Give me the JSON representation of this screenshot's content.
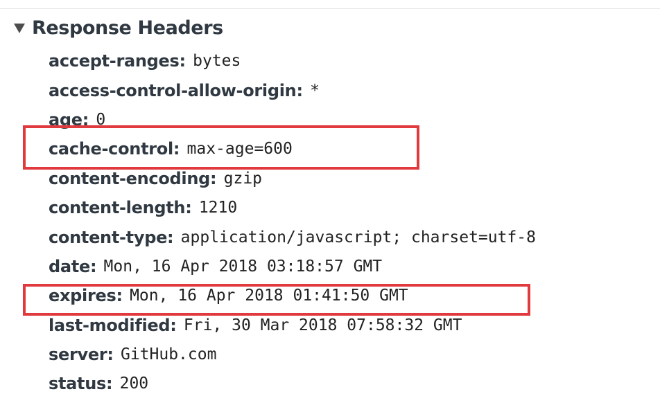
{
  "section": {
    "title": "Response Headers",
    "expanded_icon": "triangle-down-icon"
  },
  "headers": [
    {
      "name": "accept-ranges",
      "value": "bytes"
    },
    {
      "name": "access-control-allow-origin",
      "value": "*"
    },
    {
      "name": "age",
      "value": "0"
    },
    {
      "name": "cache-control",
      "value": "max-age=600"
    },
    {
      "name": "content-encoding",
      "value": "gzip"
    },
    {
      "name": "content-length",
      "value": "1210"
    },
    {
      "name": "content-type",
      "value": "application/javascript; charset=utf-8"
    },
    {
      "name": "date",
      "value": "Mon, 16 Apr 2018 03:18:57 GMT"
    },
    {
      "name": "expires",
      "value": "Mon, 16 Apr 2018 01:41:50 GMT"
    },
    {
      "name": "last-modified",
      "value": "Fri, 30 Mar 2018 07:58:32 GMT"
    },
    {
      "name": "server",
      "value": "GitHub.com"
    },
    {
      "name": "status",
      "value": "200"
    }
  ],
  "highlight": {
    "color": "#e03a3e",
    "highlighted_headers": [
      "cache-control",
      "expires"
    ]
  },
  "separator": ":"
}
